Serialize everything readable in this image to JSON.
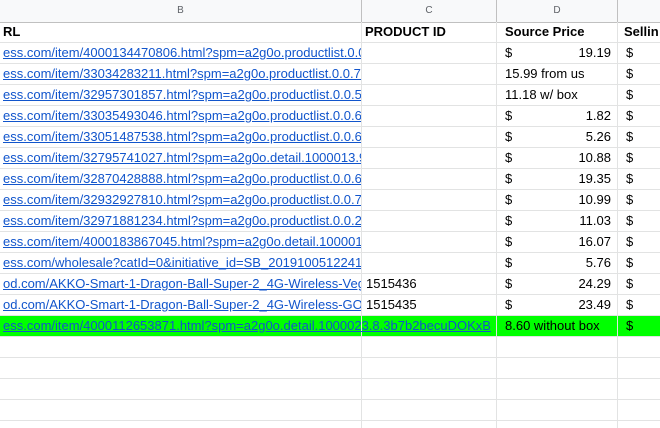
{
  "columns": [
    "B",
    "C",
    "D"
  ],
  "headers": {
    "b": "RL",
    "c": "PRODUCT ID",
    "d": "Source Price",
    "e": "Sellin"
  },
  "rows": [
    {
      "url": "ess.com/item/4000134470806.html?spm=a2g0o.productlist.0.0.",
      "pid": "",
      "cur": "$",
      "price": "19.19",
      "text": "",
      "e": "$",
      "hl": false
    },
    {
      "url": "ess.com/item/33034283211.html?spm=a2g0o.productlist.0.0.7f0",
      "pid": "",
      "cur": "",
      "price": "",
      "text": "15.99 from us",
      "e": "$",
      "hl": false
    },
    {
      "url": "ess.com/item/32957301857.html?spm=a2g0o.productlist.0.0.55",
      "pid": "",
      "cur": "",
      "price": "",
      "text": "11.18 w/ box",
      "e": "$",
      "hl": false
    },
    {
      "url": "ess.com/item/33035493046.html?spm=a2g0o.productlist.0.0.66",
      "pid": "",
      "cur": "$",
      "price": "1.82",
      "text": "",
      "e": "$",
      "hl": false
    },
    {
      "url": "ess.com/item/33051487538.html?spm=a2g0o.productlist.0.0.66",
      "pid": "",
      "cur": "$",
      "price": "5.26",
      "text": "",
      "e": "$",
      "hl": false
    },
    {
      "url": "ess.com/item/32795741027.html?spm=a2g0o.detail.1000013.9.",
      "pid": "",
      "cur": "$",
      "price": "10.88",
      "text": "",
      "e": "$",
      "hl": false
    },
    {
      "url": "ess.com/item/32870428888.html?spm=a2g0o.productlist.0.0.66",
      "pid": "",
      "cur": "$",
      "price": "19.35",
      "text": "",
      "e": "$",
      "hl": false
    },
    {
      "url": "ess.com/item/32932927810.html?spm=a2g0o.productlist.0.0.7f6",
      "pid": "",
      "cur": "$",
      "price": "10.99",
      "text": "",
      "e": "$",
      "hl": false
    },
    {
      "url": "ess.com/item/32971881234.html?spm=a2g0o.productlist.0.0.29",
      "pid": "",
      "cur": "$",
      "price": "11.03",
      "text": "",
      "e": "$",
      "hl": false
    },
    {
      "url": "ess.com/item/4000183867045.html?spm=a2g0o.detail.1000015",
      "pid": "",
      "cur": "$",
      "price": "16.07",
      "text": "",
      "e": "$",
      "hl": false
    },
    {
      "url": "ess.com/wholesale?catId=0&initiative_id=SB_20191005122416",
      "pid": "",
      "cur": "$",
      "price": "5.76",
      "text": "",
      "e": "$",
      "hl": false
    },
    {
      "url": "od.com/AKKO-Smart-1-Dragon-Ball-Super-2_4G-Wireless-Veg",
      "pid": "1515436",
      "cur": "$",
      "price": "24.29",
      "text": "",
      "e": "$",
      "hl": false
    },
    {
      "url": "od.com/AKKO-Smart-1-Dragon-Ball-Super-2_4G-Wireless-GOI",
      "pid": "1515435",
      "cur": "$",
      "price": "23.49",
      "text": "",
      "e": "$",
      "hl": false
    },
    {
      "url": "ess.com/item/4000112653871.html?spm=a2g0o.detail.1000023.8.3b7b2becuDOKxB",
      "pid": "",
      "cur": "",
      "price": "",
      "text": "8.60 without box",
      "e": "$",
      "hl": true
    }
  ],
  "colors": {
    "highlight": "#00ff00",
    "link": "#1155cc",
    "header_bg": "#f8f9fa"
  }
}
